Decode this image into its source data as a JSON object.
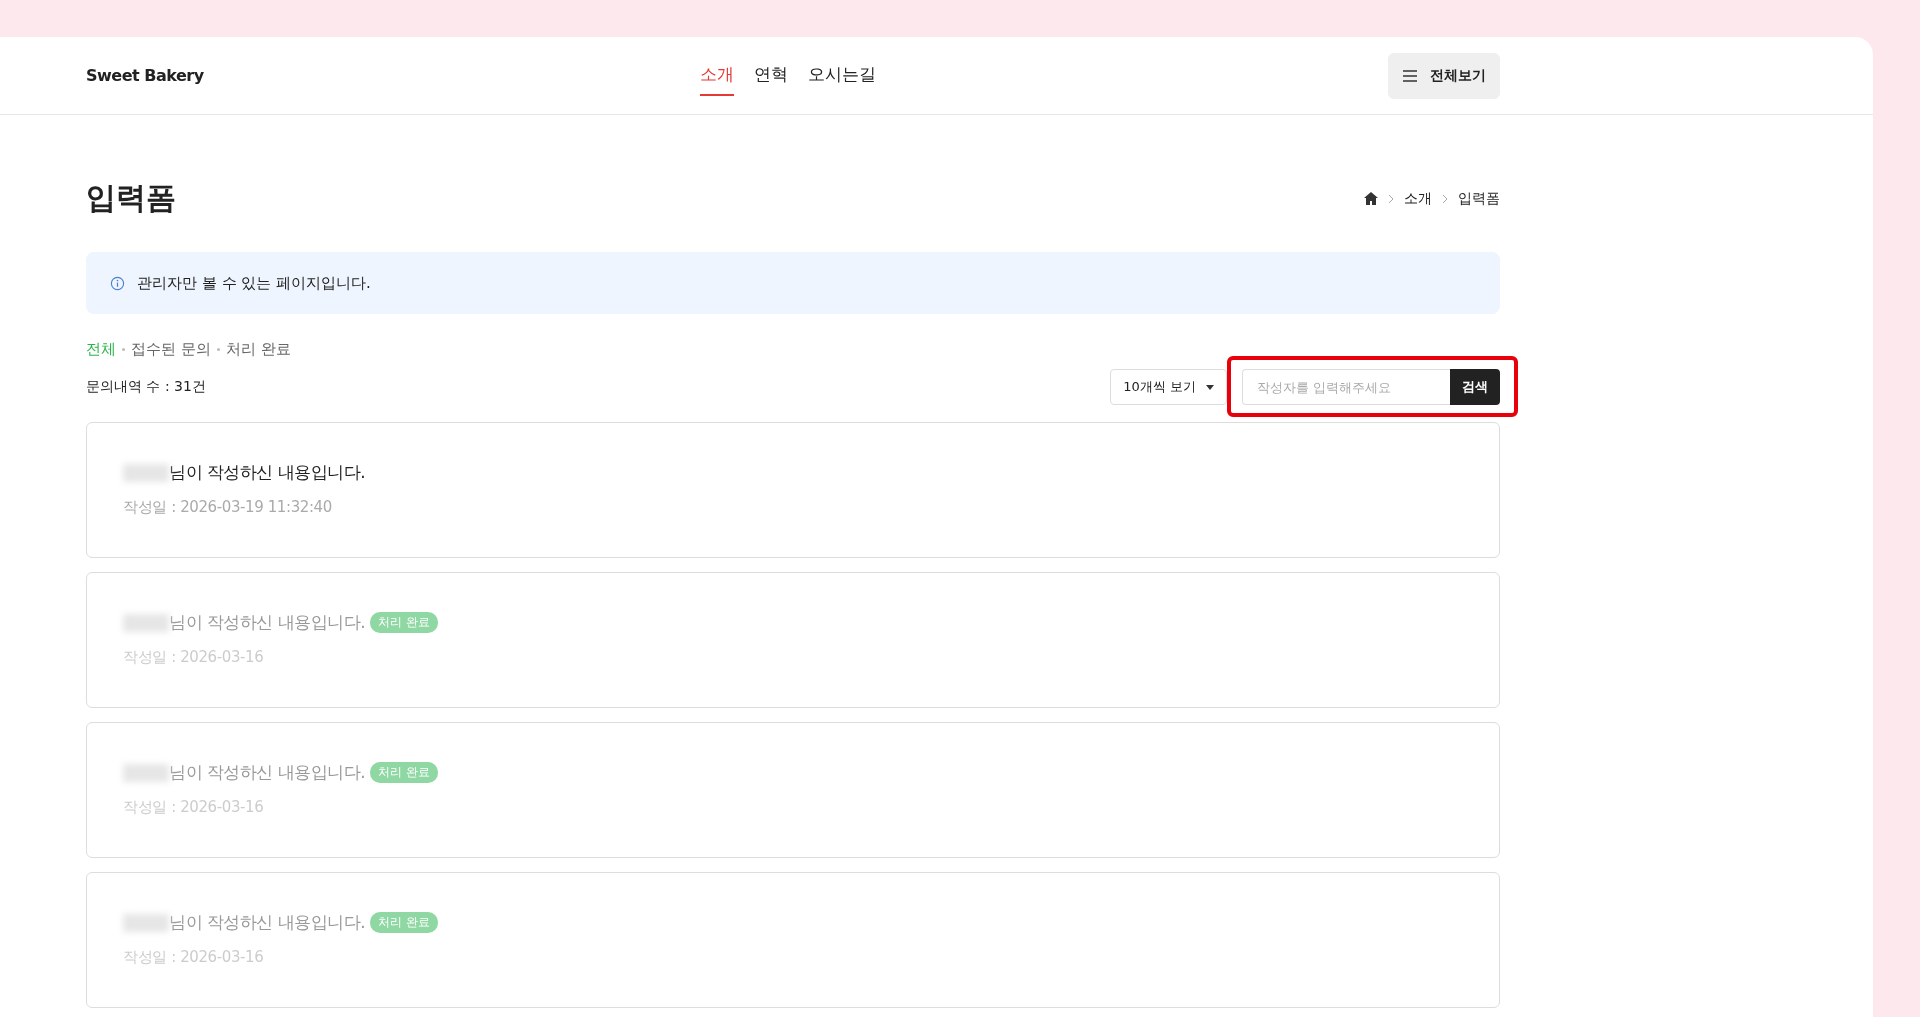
{
  "header": {
    "logo": "Sweet Bakery",
    "nav": [
      {
        "label": "소개",
        "selected": true
      },
      {
        "label": "연혁",
        "selected": false
      },
      {
        "label": "오시는길",
        "selected": false
      }
    ],
    "menu_button": "전체보기"
  },
  "page": {
    "title": "입력폼",
    "breadcrumb": [
      "소개",
      "입력폼"
    ]
  },
  "notice": "관리자만 볼 수 있는 페이지입니다.",
  "filters": [
    {
      "label": "전체",
      "selected": true
    },
    {
      "label": "접수된 문의",
      "selected": false
    },
    {
      "label": "처리 완료",
      "selected": false
    }
  ],
  "count": "문의내역 수 : 31건",
  "page_size": "10개씩 보기",
  "search": {
    "placeholder": "작성자를 입력해주세요",
    "button": "검색",
    "highlighted": true
  },
  "posts": [
    {
      "text": "님이 작성하신 내용입니다.",
      "date": "작성일 : 2026-03-19 11:32:40",
      "done": false
    },
    {
      "text": "님이 작성하신 내용입니다.",
      "date": "작성일 : 2026-03-16",
      "done": true,
      "badge": "처리 완료"
    },
    {
      "text": "님이 작성하신 내용입니다.",
      "date": "작성일 : 2026-03-16",
      "done": true,
      "badge": "처리 완료"
    },
    {
      "text": "님이 작성하신 내용입니다.",
      "date": "작성일 : 2026-03-16",
      "done": true,
      "badge": "처리 완료"
    }
  ]
}
